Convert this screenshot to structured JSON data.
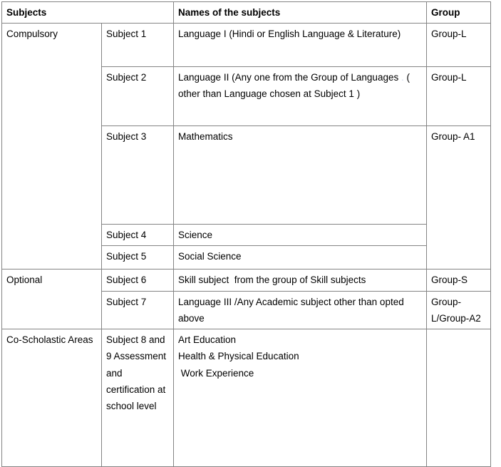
{
  "table": {
    "headers": {
      "col1": "Subjects",
      "col2": "",
      "col3": "Names of the subjects",
      "col4": "Group"
    },
    "groups": {
      "compulsory": "Compulsory",
      "optional": "Optional",
      "co_scholastic": "Co-Scholastic Areas"
    },
    "rows": [
      {
        "category": "Compulsory",
        "subject_no": "Subject 1",
        "name": "Language I (Hindi or English Language & Literature)",
        "group": "Group-L"
      },
      {
        "category": "",
        "subject_no": "Subject 2",
        "name_part1": "Language II (Any one from the Group of Languages",
        "name_dot": ".",
        "name_part2": "( other than Language chosen at Subject 1 )",
        "group": "Group-L"
      },
      {
        "category": "",
        "subject_no": "Subject 3",
        "name": "Mathematics",
        "group": "Group- A1"
      },
      {
        "category": "",
        "subject_no": "Subject 4",
        "name": "Science",
        "group": ""
      },
      {
        "category": "",
        "subject_no": "Subject 5",
        "name": "Social Science",
        "group": ""
      },
      {
        "category": "Optional",
        "subject_no": "Subject 6",
        "name": "Skill subject  from the group of Skill subjects",
        "group": "Group-S"
      },
      {
        "category": "",
        "subject_no": "Subject 7",
        "name": "Language III /Any Academic subject other than opted above",
        "group": "Group-L/Group-A2"
      },
      {
        "category": "Co-Scholastic Areas",
        "subject_no": "Subject 8 and 9 Assessment and certification at school level",
        "name_line1": "Art Education",
        "name_line2": "Health & Physical Education",
        "name_line3": " Work Experience",
        "group": ""
      }
    ]
  }
}
